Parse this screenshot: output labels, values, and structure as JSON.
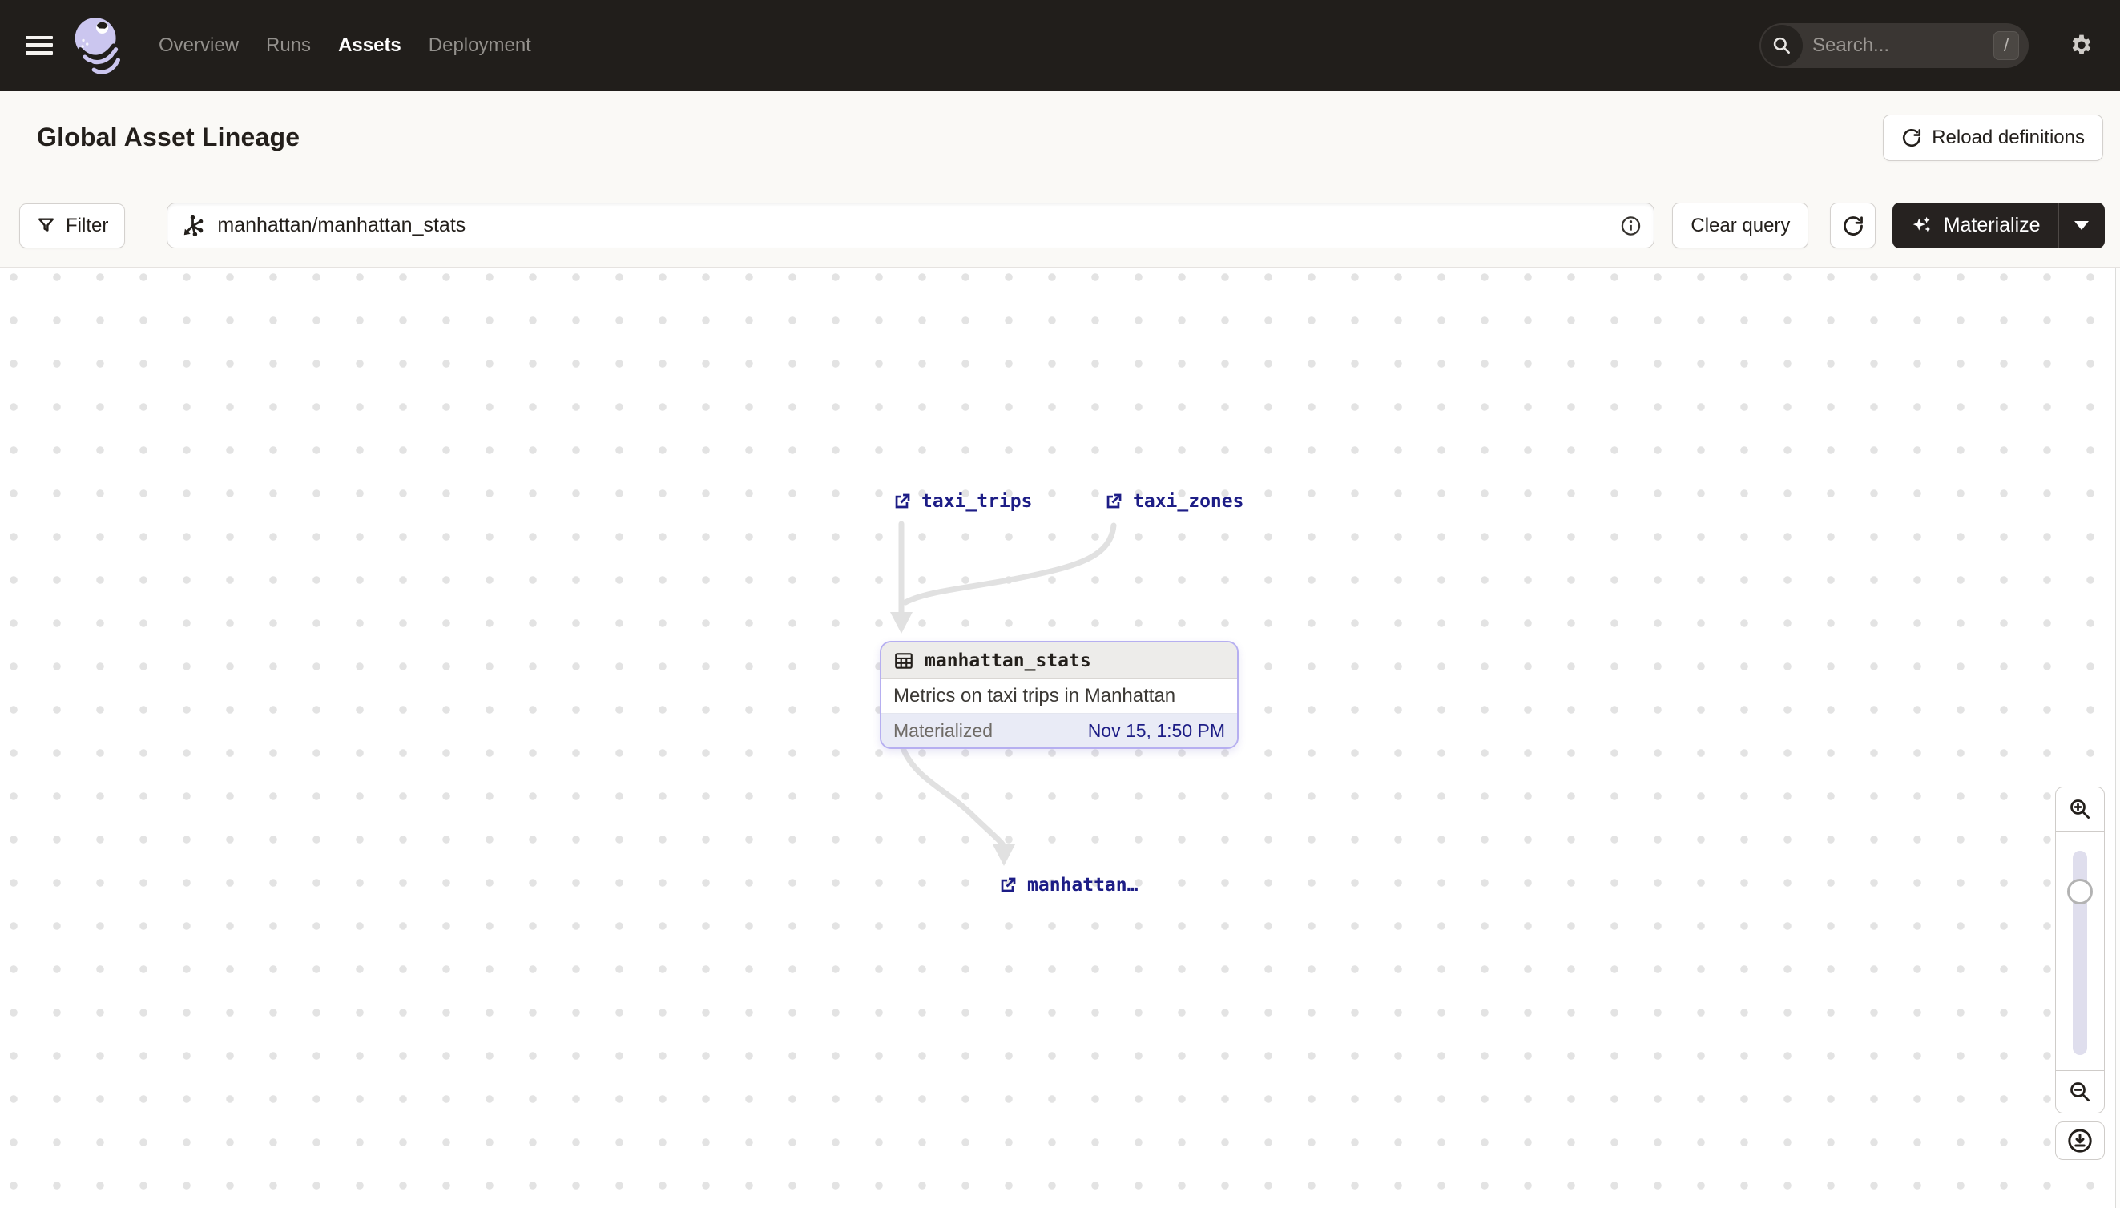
{
  "nav": {
    "links": [
      {
        "label": "Overview"
      },
      {
        "label": "Runs"
      },
      {
        "label": "Assets"
      },
      {
        "label": "Deployment"
      }
    ],
    "active_link": "Assets",
    "search_placeholder": "Search...",
    "search_shortcut": "/"
  },
  "header": {
    "title": "Global Asset Lineage",
    "reload_button": "Reload definitions"
  },
  "toolbar": {
    "filter_button": "Filter",
    "query_value": "manhattan/manhattan_stats",
    "clear_button": "Clear query",
    "materialize_button": "Materialize"
  },
  "lineage": {
    "upstream_nodes": [
      {
        "label": "taxi_trips"
      },
      {
        "label": "taxi_zones"
      }
    ],
    "selected_asset": {
      "name": "manhattan_stats",
      "description": "Metrics on taxi trips in Manhattan",
      "status_label": "Materialized",
      "materialized_at": "Nov 15, 1:50 PM"
    },
    "downstream_node": {
      "label": "manhattan…"
    }
  },
  "icons": {
    "menu": "hamburger-icon",
    "logo": "dagster-logo",
    "search": "magnifier-icon",
    "settings": "gear-icon",
    "reload": "refresh-icon",
    "filter": "funnel-icon",
    "query": "graph-selector-icon",
    "info": "info-icon",
    "materialize": "sparkles-icon",
    "asset_external": "external-link-icon",
    "asset_table": "table-icon",
    "zoom_in": "zoom-in-icon",
    "zoom_out": "zoom-out-icon",
    "download": "download-circle-icon"
  },
  "colors": {
    "nav_bg": "#211e1b",
    "page_bg": "#faf9f6",
    "selection_border": "#b6aff0",
    "asset_link_navy": "#1d1d86",
    "edge_gray": "#e1e1e1",
    "logo_lavender": "#cbc6ef"
  }
}
